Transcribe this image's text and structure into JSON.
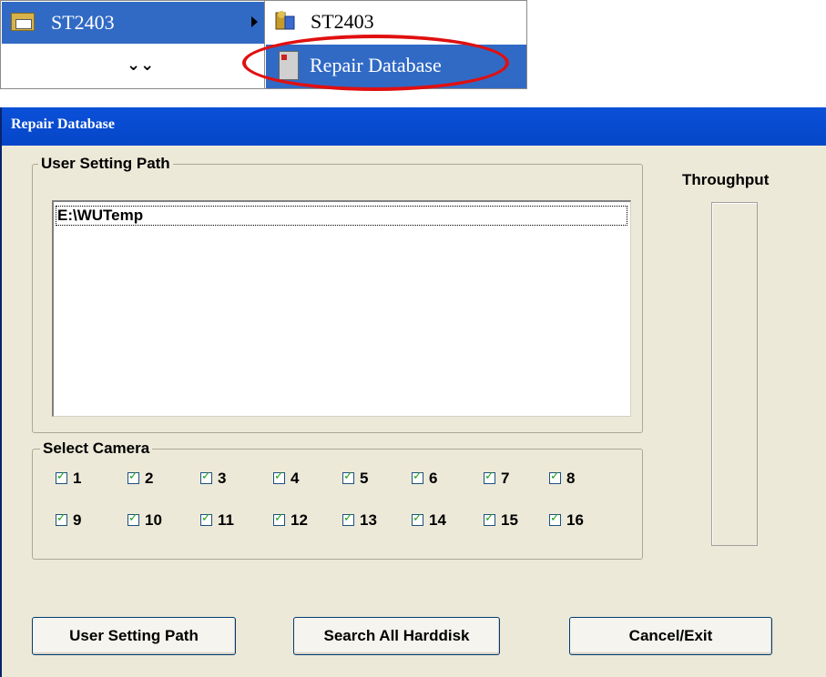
{
  "menu": {
    "parent_item": "ST2403",
    "expand_symbol": "⌄⌄",
    "sub_items": [
      "ST2403",
      "Repair Database"
    ]
  },
  "dialog": {
    "title": "Repair Database",
    "user_setting_group": "User Setting Path",
    "paths": [
      "E:\\WUTemp"
    ],
    "camera_group": "Select Camera",
    "cameras": [
      {
        "label": "1",
        "checked": true
      },
      {
        "label": "2",
        "checked": true
      },
      {
        "label": "3",
        "checked": true
      },
      {
        "label": "4",
        "checked": true
      },
      {
        "label": "5",
        "checked": true
      },
      {
        "label": "6",
        "checked": true
      },
      {
        "label": "7",
        "checked": true
      },
      {
        "label": "8",
        "checked": true
      },
      {
        "label": "9",
        "checked": true
      },
      {
        "label": "10",
        "checked": true
      },
      {
        "label": "11",
        "checked": true
      },
      {
        "label": "12",
        "checked": true
      },
      {
        "label": "13",
        "checked": true
      },
      {
        "label": "14",
        "checked": true
      },
      {
        "label": "15",
        "checked": true
      },
      {
        "label": "16",
        "checked": true
      }
    ],
    "throughput_label": "Throughput",
    "throughput_progress": 0,
    "buttons": {
      "user_setting_path": "User Setting Path",
      "search_all_harddisk": "Search All Harddisk",
      "cancel_exit": "Cancel/Exit"
    }
  },
  "colors": {
    "selection": "#316ac5",
    "highlight_ring": "#e01010",
    "dialog_bg": "#ece9d8",
    "titlebar": "#0546c8"
  }
}
